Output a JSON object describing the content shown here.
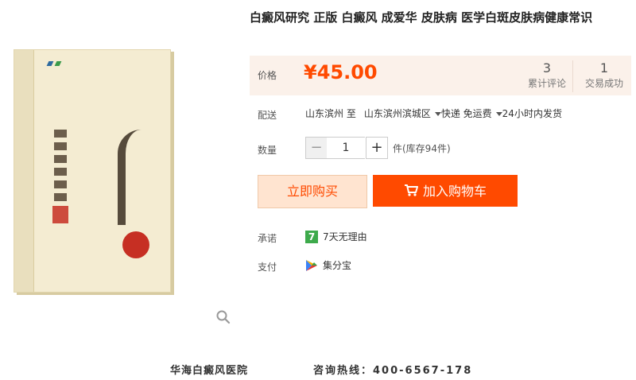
{
  "product": {
    "title": "白癜风研究 正版 白癜风 成爱华 皮肤病 医学白斑皮肤病健康常识"
  },
  "price": {
    "label": "价格",
    "value": "¥45.00",
    "reviews_count": "3",
    "reviews_label": "累计评论",
    "trades_count": "1",
    "trades_label": "交易成功"
  },
  "shipping": {
    "label": "配送",
    "from": "山东滨州 至",
    "to": "山东滨州滨城区",
    "method": "快递 免运费",
    "dispatch": "24小时内发货"
  },
  "quantity": {
    "label": "数量",
    "value": "1",
    "minus": "−",
    "plus": "+",
    "stock": "件(库存94件)"
  },
  "actions": {
    "buy_now": "立即购买",
    "add_to_cart": "加入购物车"
  },
  "promise": {
    "label": "承诺",
    "icon_text": "7",
    "text": "7天无理由"
  },
  "payment": {
    "label": "支付",
    "text": "集分宝"
  },
  "footer": {
    "hospital": "华海白癜风医院",
    "hotline": "咨询热线：400-6567-178"
  },
  "icons": {
    "zoom": "magnifier-icon",
    "cart": "cart-icon",
    "promise": "seven-day-icon",
    "payment": "jifenbao-icon"
  },
  "colors": {
    "accent": "#ff4a00",
    "price_bg": "#fbf1ea",
    "buy_bg": "#ffe4d0",
    "promise_green": "#3daa4b"
  }
}
